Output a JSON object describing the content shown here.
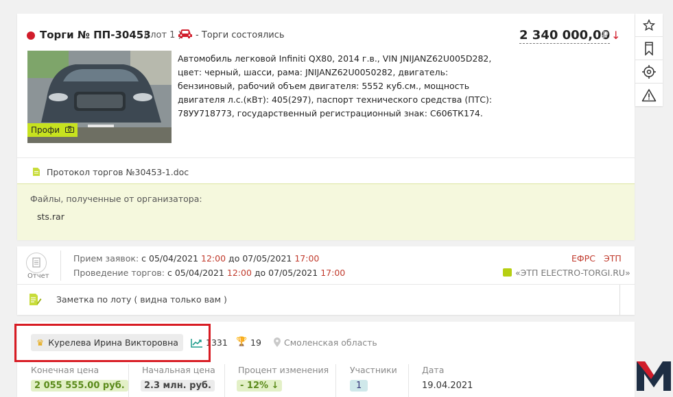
{
  "lot": {
    "title": "Торги № ПП-30453",
    "lot_number": "( лот 1 )",
    "status": "- Торги состоялись",
    "price": "2 340 000,00",
    "currency": "₽",
    "price_trend_icon": "arrow-down-icon",
    "photo_badge": "Профи",
    "description": "Автомобиль легковой Infiniti QX80, 2014 г.в., VIN JNIJANZ62U005D282, цвет: черный, шасси, рама: JNIJANZ62U0050282, двигатель: бензиновый, рабочий объем двигателя: 5552 куб.см., мощность двигателя л.с.(кВт): 405(297), паспорт технического средства (ПТС): 78УУ718773, государственный регистрационный знак: С606ТК174.",
    "protocol": "Протокол торгов №30453-1.doc",
    "files_label": "Файлы, полученные от организатора:",
    "file_name": "sts.rar",
    "status_color": "#d11c2a"
  },
  "side_toolbar": {
    "icons": [
      "star-icon",
      "bookmark-icon",
      "target-icon",
      "warning-icon"
    ]
  },
  "dates": {
    "report_label": "Отчет",
    "applications_label": "Прием заявок:",
    "applications_from_prefix": "с",
    "applications_from_date": "05/04/2021",
    "applications_from_time": "12:00",
    "applications_to_prefix": "до",
    "applications_to_date": "07/05/2021",
    "applications_to_time": "17:00",
    "auction_label": "Проведение торгов:",
    "auction_from_prefix": "с",
    "auction_from_date": "05/04/2021",
    "auction_from_time": "12:00",
    "auction_to_prefix": "до",
    "auction_to_date": "07/05/2021",
    "auction_to_time": "17:00",
    "efrs": "ЕФРС",
    "etp": "ЭТП",
    "etp_link": "«ЭТП ELECTRO-TORGI.RU»",
    "note": "Заметка по лоту ( видна только вам )"
  },
  "winner": {
    "name": "Курелева  Ирина  Викторовна",
    "rating": "1331",
    "wins": "19",
    "region": "Смоленская область",
    "columns": [
      {
        "header": "Конечная цена",
        "value": "2 055 555.00 руб.",
        "bg": "#e3f0c7",
        "color": "#5a8a1a"
      },
      {
        "header": "Начальная цена",
        "value": "2.3 млн. руб.",
        "bg": "#ececec",
        "color": "#444"
      },
      {
        "header": "Процент изменения",
        "value": "- 12% ↓",
        "bg": "#e3f0c7",
        "color": "#5a8a1a"
      },
      {
        "header": "Участники",
        "value": "1",
        "bg": "#cfe8ea",
        "color": "#337"
      },
      {
        "header": "Дата",
        "value": "19.04.2021",
        "bg": "transparent",
        "color": "#333"
      }
    ]
  }
}
